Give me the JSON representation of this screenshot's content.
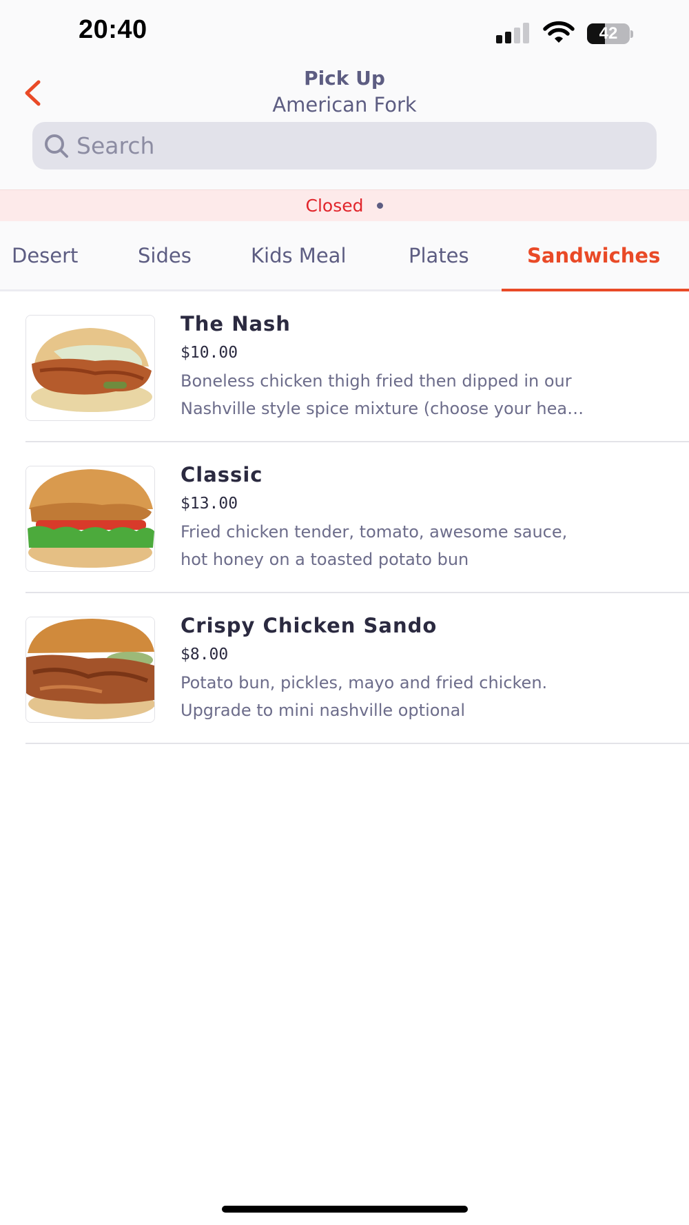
{
  "status_bar": {
    "time": "20:40",
    "battery": "42",
    "battery_level": 0.42,
    "icons": [
      "signal-icon",
      "wifi-icon",
      "battery-icon"
    ]
  },
  "header": {
    "title": "Pick Up",
    "subtitle": "American Fork",
    "back_icon": "chevron-left-icon"
  },
  "search": {
    "placeholder": "Search",
    "value": "",
    "icon": "search-icon"
  },
  "status_banner": {
    "text": "Closed"
  },
  "tabs": [
    {
      "label": "Desert",
      "active": false
    },
    {
      "label": "Sides",
      "active": false
    },
    {
      "label": "Kids Meal",
      "active": false
    },
    {
      "label": "Plates",
      "active": false
    },
    {
      "label": "Sandwiches",
      "active": true
    }
  ],
  "menu": {
    "items": [
      {
        "name": "The Nash",
        "price": "$10.00",
        "description_lines": [
          "Boneless chicken thigh fried then dipped in our",
          "Nashville style spice mixture (choose your hea…"
        ]
      },
      {
        "name": "Classic",
        "price": "$13.00",
        "description_lines": [
          "Fried chicken tender, tomato, awesome sauce,",
          "hot honey on a toasted potato bun"
        ]
      },
      {
        "name": "Crispy Chicken Sando",
        "price": "$8.00",
        "description_lines": [
          "Potato bun, pickles, mayo and fried chicken.",
          "Upgrade to mini nashville optional"
        ]
      }
    ]
  },
  "colors": {
    "accent": "#e94a27",
    "closed": "#e1252b",
    "closed_banner_bg": "#fdeaea",
    "text_primary": "#2b2a40",
    "text_secondary": "#6c6c8a",
    "header_text": "#5d5d82",
    "search_bg": "#e2e2ea"
  }
}
